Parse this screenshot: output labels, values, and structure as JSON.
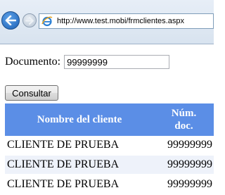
{
  "browser": {
    "url": "http://www.test.mobi/frmclientes.aspx"
  },
  "form": {
    "document_label": "Documento:",
    "document_value": "99999999",
    "submit_label": "Consultar"
  },
  "table": {
    "headers": {
      "name": "Nombre del cliente",
      "doc_line1": "Núm.",
      "doc_line2": "doc."
    },
    "rows": [
      {
        "name": "CLIENTE DE PRUEBA",
        "doc": "99999999"
      },
      {
        "name": "CLIENTE DE PRUEBA",
        "doc": "99999999"
      },
      {
        "name": "CLIENTE DE PRUEBA",
        "doc": "99999999"
      }
    ]
  },
  "colors": {
    "header_bg": "#5b8ee6",
    "alt_row_bg": "#eef2fa"
  }
}
